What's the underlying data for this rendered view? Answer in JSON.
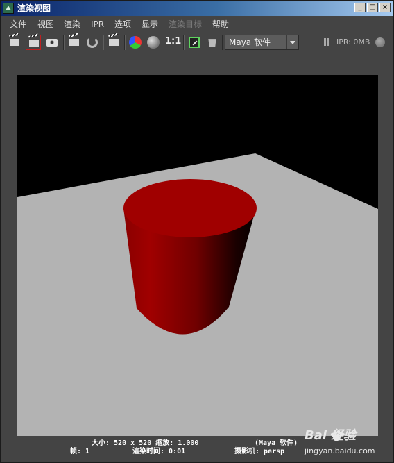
{
  "window": {
    "title": "渲染视图",
    "minimize": "_",
    "maximize": "□",
    "close": "×"
  },
  "menu": {
    "items": [
      {
        "label": "文件",
        "disabled": false
      },
      {
        "label": "视图",
        "disabled": false
      },
      {
        "label": "渲染",
        "disabled": false
      },
      {
        "label": "IPR",
        "disabled": false
      },
      {
        "label": "选项",
        "disabled": false
      },
      {
        "label": "显示",
        "disabled": false
      },
      {
        "label": "渲染目标",
        "disabled": true
      },
      {
        "label": "帮助",
        "disabled": false
      }
    ]
  },
  "toolbar": {
    "icons": [
      "render-clapper-icon",
      "render-region-icon",
      "snapshot-camera-icon",
      "ipr-clapper-icon",
      "refresh-icon",
      "render-settings-icon",
      "rgb-channels-icon",
      "alpha-channel-icon",
      "keep-image-icon",
      "remove-image-icon"
    ],
    "ratio_label": "1:1",
    "renderer": "Maya 软件",
    "ipr_status": "IPR: 0MB"
  },
  "colors": {
    "accent_red": "#c02020",
    "floor": "#b3b3b3",
    "cylinder": "#a00000",
    "background": "#444444"
  },
  "status": {
    "size": "大小: 520 x 520 缩放: 1.000",
    "renderer": "(Maya 软件)",
    "frame": "帧: 1",
    "render_time": "渲染时间: 0:01",
    "camera": "摄影机: persp"
  },
  "watermark": {
    "brand": "Bai  经验",
    "url": "jingyan.baidu.com"
  }
}
